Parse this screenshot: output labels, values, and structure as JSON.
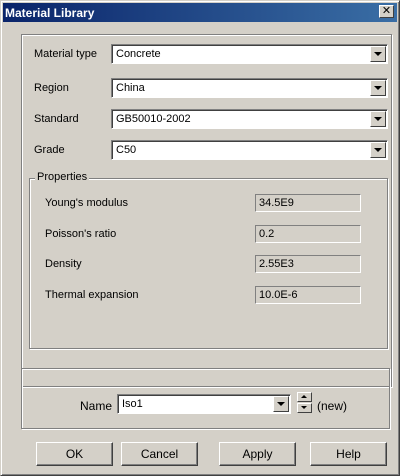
{
  "window": {
    "title": "Material Library",
    "close_glyph": "✕"
  },
  "fields": {
    "material_type": {
      "label": "Material type",
      "value": "Concrete"
    },
    "region": {
      "label": "Region",
      "value": "China"
    },
    "standard": {
      "label": "Standard",
      "value": "GB50010-2002"
    },
    "grade": {
      "label": "Grade",
      "value": "C50"
    }
  },
  "properties": {
    "title": "Properties",
    "items": [
      {
        "label": "Young's modulus",
        "value": "34.5E9"
      },
      {
        "label": "Poisson's ratio",
        "value": "0.2"
      },
      {
        "label": "Density",
        "value": "2.55E3"
      },
      {
        "label": "Thermal expansion",
        "value": "10.0E-6"
      }
    ]
  },
  "name_box": {
    "label": "Name",
    "value": "Iso1",
    "status": "(new)"
  },
  "buttons": {
    "ok": "OK",
    "cancel": "Cancel",
    "apply": "Apply",
    "help": "Help"
  },
  "icons": [
    "close-icon",
    "dropdown-arrow-icon",
    "spin-up-icon",
    "spin-down-icon"
  ],
  "colors": {
    "titlebar_start": "#0a246a",
    "titlebar_end": "#3a6ea5",
    "face": "#d4d0c8"
  }
}
